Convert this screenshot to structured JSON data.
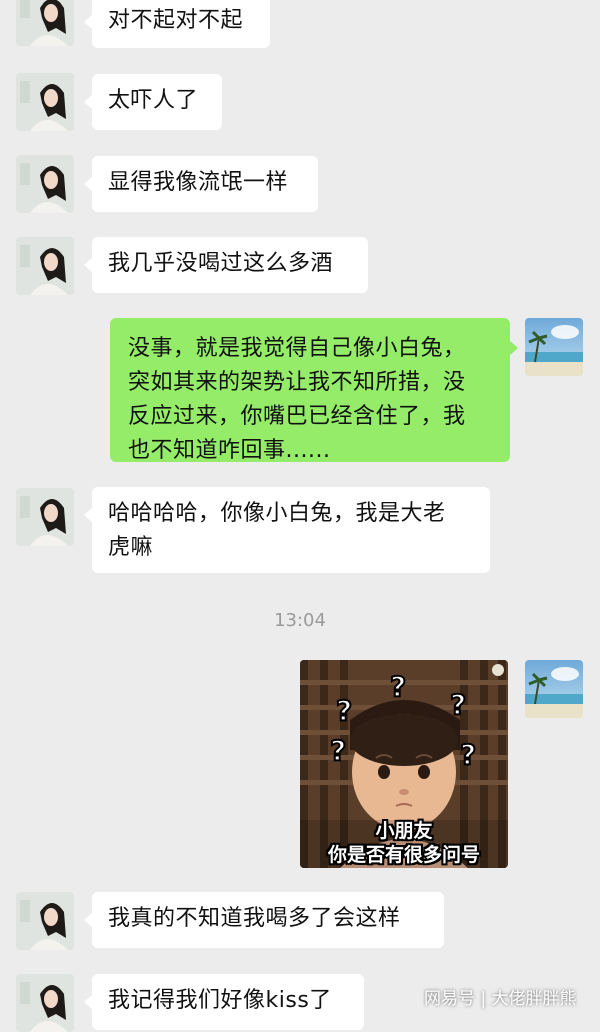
{
  "messages": [
    {
      "side": "in",
      "text": "对不起对不起"
    },
    {
      "side": "in",
      "text": "太吓人了"
    },
    {
      "side": "in",
      "text": "显得我像流氓一样"
    },
    {
      "side": "in",
      "text": "我几乎没喝过这么多酒"
    },
    {
      "side": "out",
      "text": "没事，就是我觉得自己像小白兔，\n突如其来的架势让我不知所措，没\n反应过来，你嘴巴已经含住了，我\n也不知道咋回事......"
    },
    {
      "side": "in",
      "text": "哈哈哈哈，你像小白兔，我是大老\n虎嘛"
    },
    {
      "side": "in",
      "text": "我真的不知道我喝多了会这样"
    },
    {
      "side": "in",
      "text": "我记得我们好像kiss了"
    }
  ],
  "timestamp": "13:04",
  "sticker": {
    "caption_line1": "小朋友",
    "caption_line2": "你是否有很多问号"
  },
  "watermark": "网易号 | 大佬胖胖熊",
  "colors": {
    "background": "#ececec",
    "incoming_bubble": "#ffffff",
    "outgoing_bubble": "#95ec69"
  }
}
